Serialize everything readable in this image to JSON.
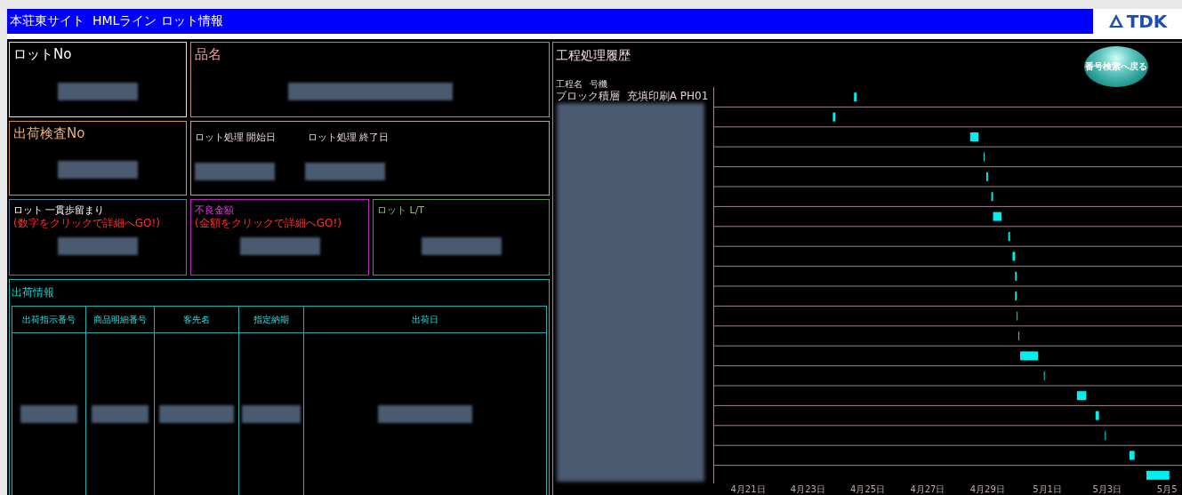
{
  "window": {
    "title": "本荘東サイト  HMLライン ロット情報",
    "logo": "TDK"
  },
  "lot_no": {
    "label": "ロットNo"
  },
  "product_name": {
    "label": "品名"
  },
  "shipping_inspection_no": {
    "label": "出荷検査No"
  },
  "lot_processing": {
    "start_label": "ロット処理 開始日",
    "end_label": "ロット処理 終了日"
  },
  "yield": {
    "label": "ロット 一貫歩留まり",
    "hint": "(数字をクリックで詳細へGO!)"
  },
  "defect_amount": {
    "label": "不良金額",
    "hint": "(金額をクリックで詳細へGO!)"
  },
  "lead_time": {
    "label": "ロット L/T"
  },
  "shipping": {
    "title": "出荷情報",
    "columns": [
      "出荷指示番号",
      "商品明細番号",
      "客先名",
      "指定納期",
      "出荷日"
    ]
  },
  "process_history": {
    "title": "工程処理履歴",
    "back_button": "番号検索へ戻る",
    "columns": [
      "工程名",
      "号機"
    ],
    "first_row": {
      "process": "ブロック積層  充填印刷A",
      "machine": "PH01"
    },
    "axis_labels": [
      "4月21日",
      "4月23日",
      "4月25日",
      "4月27日",
      "4月29日",
      "5月1日",
      "5月3日",
      "5月5"
    ]
  }
}
